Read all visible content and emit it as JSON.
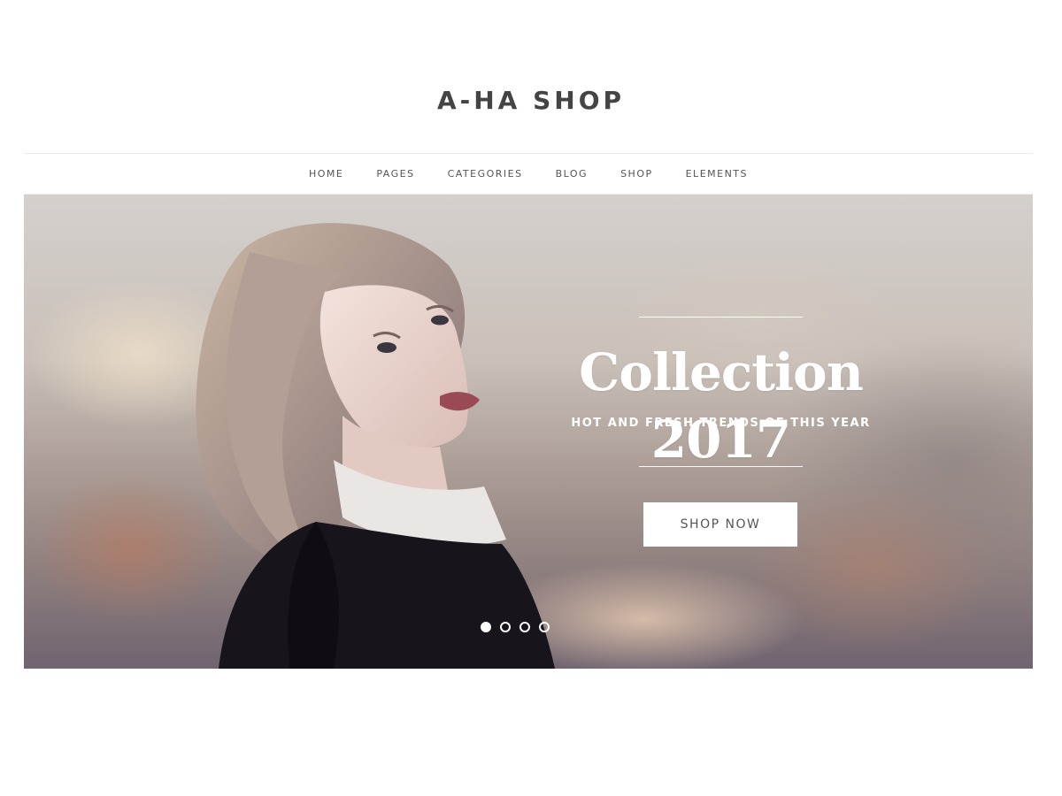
{
  "header": {
    "logo": "A-HA SHOP"
  },
  "nav": {
    "items": [
      {
        "label": "HOME"
      },
      {
        "label": "PAGES"
      },
      {
        "label": "CATEGORIES"
      },
      {
        "label": "BLOG"
      },
      {
        "label": "SHOP"
      },
      {
        "label": "ELEMENTS"
      }
    ]
  },
  "hero": {
    "title": "Collection 2017",
    "subtitle": "HOT AND FRESH TRENDS OF THIS YEAR",
    "button_label": "SHOP NOW",
    "slides_total": 4,
    "active_slide": 1
  }
}
